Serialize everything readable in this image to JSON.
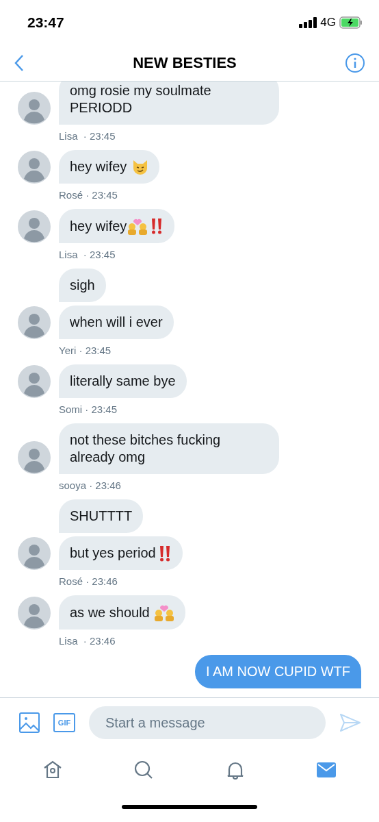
{
  "status_bar": {
    "time": "23:47",
    "network": "4G",
    "charging": true
  },
  "header": {
    "title": "NEW BESTIES"
  },
  "groups": [
    {
      "meta": "Lisa  · 23:45",
      "messages": [
        {
          "text": "omg rosie my soulmate PERIODD"
        }
      ]
    },
    {
      "meta": "Rosé · 23:45",
      "messages": [
        {
          "text": "hey wifey ",
          "emoji": [
            {
              "kind": "cat"
            }
          ]
        }
      ]
    },
    {
      "meta": "Lisa  · 23:45",
      "messages": [
        {
          "text": "hey wifey",
          "emoji": [
            {
              "kind": "couple"
            },
            {
              "kind": "exclamation"
            }
          ]
        }
      ]
    },
    {
      "meta": "Yeri · 23:45",
      "messages": [
        {
          "text": "sigh"
        },
        {
          "text": "when will i ever"
        }
      ]
    },
    {
      "meta": "Somi · 23:45",
      "messages": [
        {
          "text": "literally same bye"
        }
      ]
    },
    {
      "meta": "sooya · 23:46",
      "messages": [
        {
          "text": "not these bitches fucking already omg"
        }
      ]
    },
    {
      "meta": "Rosé · 23:46",
      "messages": [
        {
          "text": "SHUTTTT"
        },
        {
          "text": "but yes period",
          "emoji": [
            {
              "kind": "exclamation"
            }
          ]
        }
      ]
    },
    {
      "meta": "Lisa  · 23:46",
      "messages": [
        {
          "text": "as we should ",
          "emoji": [
            {
              "kind": "couple"
            }
          ]
        }
      ]
    }
  ],
  "sent": [
    {
      "text": "I AM NOW CUPID WTF"
    }
  ],
  "composer": {
    "placeholder": "Start a message",
    "gif_label": "GIF"
  },
  "tabs": [
    {
      "kind": "home",
      "selected": false
    },
    {
      "kind": "search",
      "selected": false
    },
    {
      "kind": "notifications",
      "selected": false
    },
    {
      "kind": "messages",
      "selected": true
    }
  ]
}
